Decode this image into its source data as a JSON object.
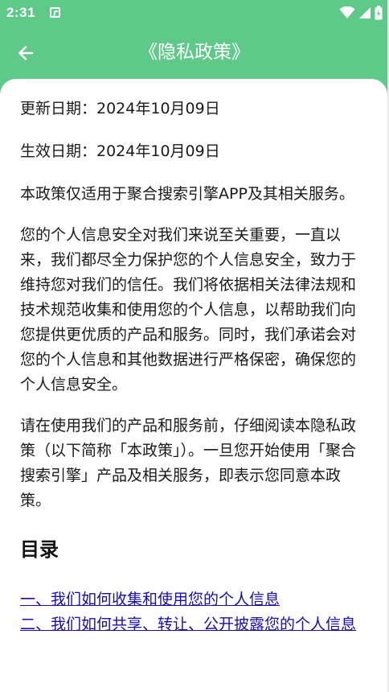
{
  "status_bar": {
    "time": "2:31",
    "notification_icon": "text-a-notification-icon",
    "icons": [
      "wifi-icon",
      "cell-signal-icon",
      "battery-icon"
    ]
  },
  "header": {
    "back_icon": "arrow-left-icon",
    "title": "《隐私政策》"
  },
  "colors": {
    "primary": "#5fc98a",
    "link": "#1a0dab",
    "text": "#1a1a1a"
  },
  "policy": {
    "updated_date": "更新日期：2024年10月09日",
    "effective_date": "生效日期：2024年10月09日",
    "scope": "本政策仅适用于聚合搜索引擎APP及其相关服务。",
    "intro_1": "您的个人信息安全对我们来说至关重要，一直以来，我们都尽全力保护您的个人信息安全，致力于维持您对我们的信任。我们将依据相关法律法规和技术规范收集和使用您的个人信息，以帮助我们向您提供更优质的产品和服务。同时，我们承诺会对您的个人信息和其他数据进行严格保密，确保您的个人信息安全。",
    "intro_2": "请在使用我们的产品和服务前，仔细阅读本隐私政策（以下简称「本政策」）。一旦您开始使用「聚合搜索引擎」产品及相关服务，即表示您同意本政策。",
    "toc_heading": "目录",
    "toc": [
      "一、我们如何收集和使用您的个人信息",
      "二、我们如何共享、转让、公开披露您的个人信息"
    ]
  }
}
